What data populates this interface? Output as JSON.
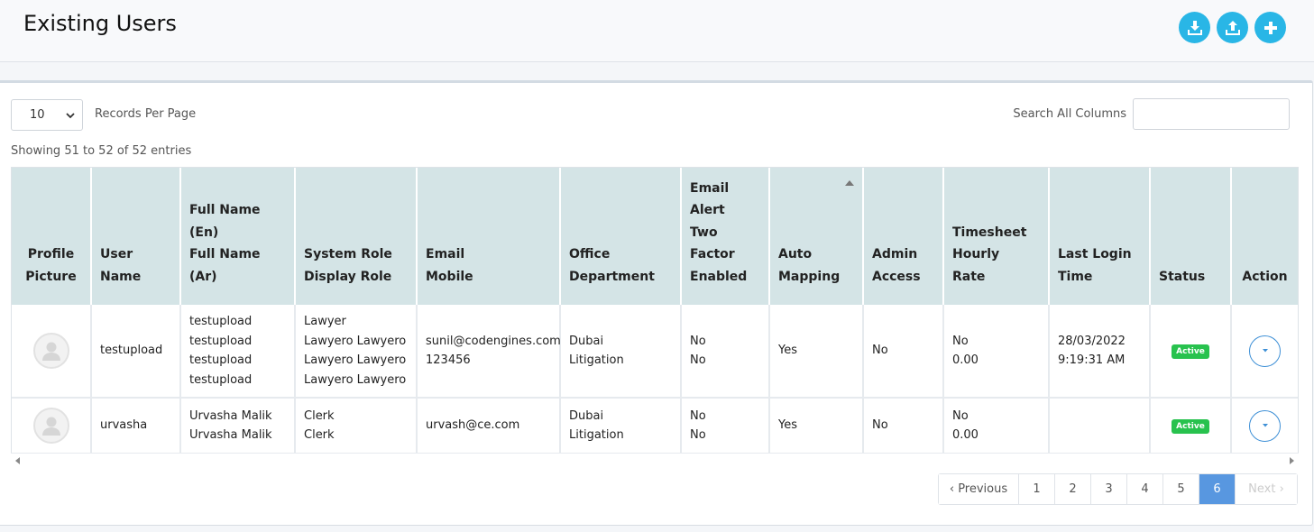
{
  "header": {
    "title": "Existing Users",
    "actions": [
      {
        "icon": "download-icon"
      },
      {
        "icon": "upload-icon"
      },
      {
        "icon": "plus-icon"
      }
    ],
    "accent_color": "#29b6e6"
  },
  "controls": {
    "records_per_page": "10",
    "records_per_page_label": "Records Per Page",
    "search_label": "Search All Columns",
    "search_value": "",
    "info": "Showing 51 to 52 of 52 entries"
  },
  "table": {
    "columns": [
      {
        "lines": [
          "Profile",
          "Picture"
        ]
      },
      {
        "lines": [
          "User",
          "Name"
        ]
      },
      {
        "lines": [
          "Full Name",
          "(En)",
          "Full Name",
          "(Ar)"
        ]
      },
      {
        "lines": [
          "System Role",
          "Display Role"
        ]
      },
      {
        "lines": [
          "Email",
          "Mobile"
        ]
      },
      {
        "lines": [
          "Office",
          "Department"
        ]
      },
      {
        "lines": [
          "Email",
          "Alert",
          "Two",
          "Factor",
          "Enabled"
        ]
      },
      {
        "lines": [
          "Auto",
          "Mapping"
        ]
      },
      {
        "lines": [
          "Admin",
          "Access"
        ]
      },
      {
        "lines": [
          "Timesheet",
          "Hourly",
          "Rate"
        ]
      },
      {
        "lines": [
          "Last Login",
          "Time"
        ]
      },
      {
        "lines": [
          "Status"
        ]
      },
      {
        "lines": [
          "Action"
        ]
      }
    ],
    "rows": [
      {
        "username": "testupload",
        "full_name": [
          "testupload",
          "testupload",
          "testupload",
          "testupload"
        ],
        "role": [
          "Lawyer",
          "Lawyero Lawyero",
          "Lawyero Lawyero",
          "Lawyero Lawyero"
        ],
        "contact": [
          "sunil@codengines.com",
          "123456"
        ],
        "office": [
          "Dubai",
          "Litigation"
        ],
        "email_2fa": [
          "No",
          "No"
        ],
        "auto_mapping": "Yes",
        "admin_access": "No",
        "timesheet": [
          "No",
          "0.00"
        ],
        "last_login": [
          "28/03/2022",
          "9:19:31 AM"
        ],
        "status": "Active"
      },
      {
        "username": "urvasha",
        "full_name": [
          "Urvasha Malik",
          "Urvasha Malik"
        ],
        "role": [
          "Clerk",
          "Clerk"
        ],
        "contact": [
          "urvash@ce.com"
        ],
        "office": [
          "Dubai",
          "Litigation"
        ],
        "email_2fa": [
          "No",
          "No"
        ],
        "auto_mapping": "Yes",
        "admin_access": "No",
        "timesheet": [
          "No",
          "0.00"
        ],
        "last_login": [],
        "status": "Active"
      }
    ],
    "status_color": "#28c24e"
  },
  "pagination": {
    "previous": "Previous",
    "next": "Next",
    "pages": [
      "1",
      "2",
      "3",
      "4",
      "5",
      "6"
    ],
    "active_page": "6",
    "active_color": "#5897e0"
  }
}
